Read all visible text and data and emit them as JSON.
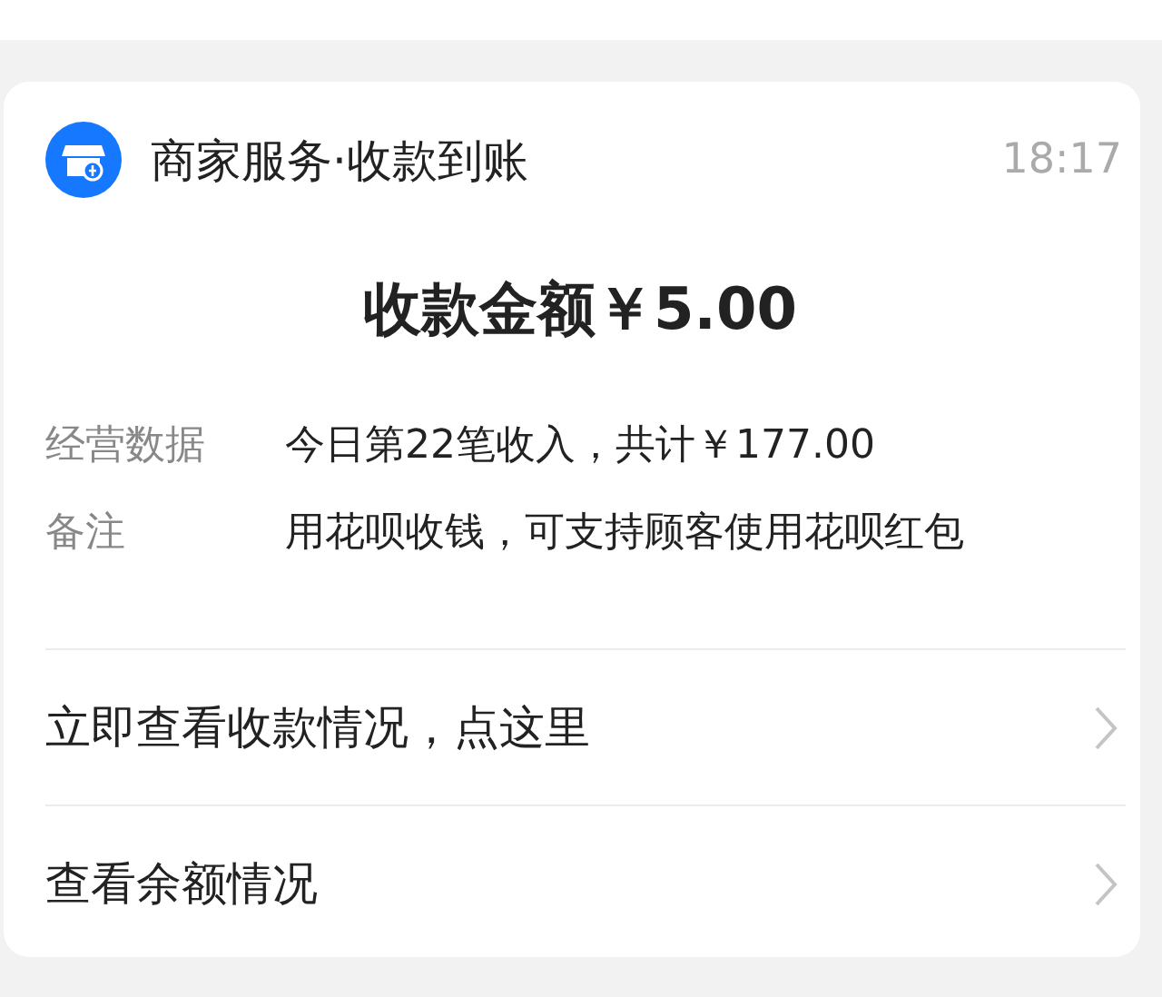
{
  "header": {
    "title": "商家服务·收款到账",
    "time": "18:17"
  },
  "amount": "收款金额￥5.00",
  "details": [
    {
      "label": "经营数据",
      "value": "今日第22笔收入，共计￥177.00"
    },
    {
      "label": "备注",
      "value": "用花呗收钱，可支持顾客使用花呗红包"
    }
  ],
  "links": [
    {
      "label": "立即查看收款情况，点这里"
    },
    {
      "label": "查看余额情况"
    }
  ]
}
